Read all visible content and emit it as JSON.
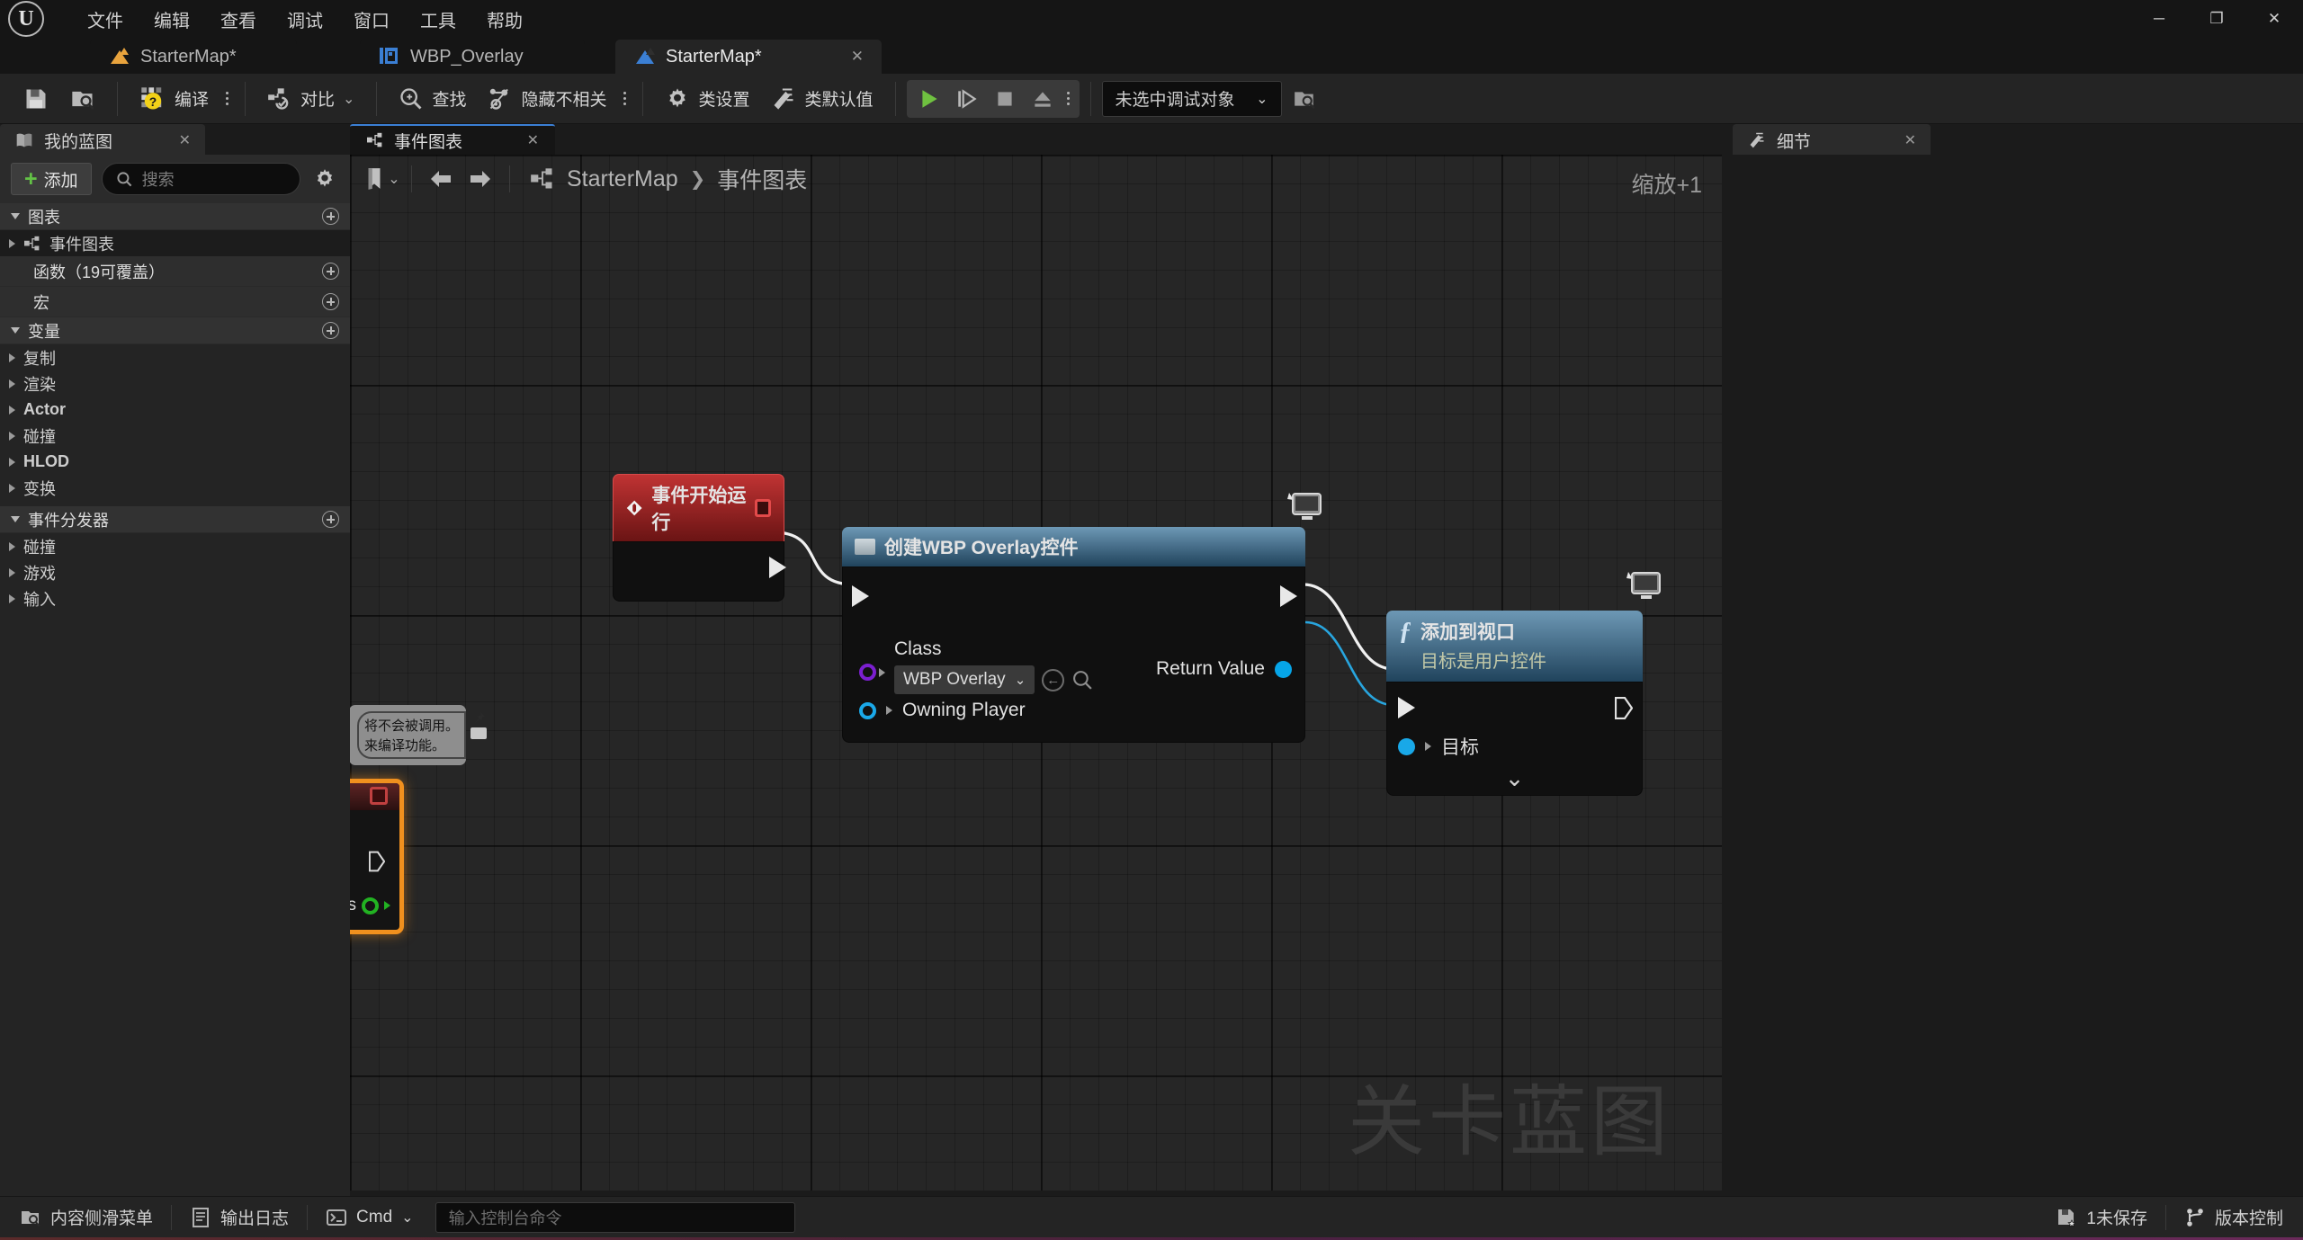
{
  "app": {
    "logo": "unreal-engine-logo",
    "menu": [
      "文件",
      "编辑",
      "查看",
      "调试",
      "窗口",
      "工具",
      "帮助"
    ],
    "window_controls": {
      "minimize": "─",
      "maximize": "❐",
      "close": "✕"
    }
  },
  "document_tabs": [
    {
      "label": "StarterMap*",
      "icon": "map-icon",
      "active": false,
      "closable": false
    },
    {
      "label": "WBP_Overlay",
      "icon": "widget-blueprint-icon",
      "active": false,
      "closable": false
    },
    {
      "label": "StarterMap*",
      "icon": "level-blueprint-icon",
      "active": true,
      "closable": true,
      "close": "✕"
    }
  ],
  "toolbar": {
    "save_icon": "save-icon",
    "browse_icon": "browse-content-icon",
    "compile_label": "编译",
    "compile_icon": "compile-icon",
    "diff_label": "对比",
    "diff_icon": "diff-icon",
    "find_label": "查找",
    "find_icon": "find-icon",
    "hide_unrelated_label": "隐藏不相关",
    "hide_unrelated_icon": "hide-unrelated-icon",
    "class_settings_label": "类设置",
    "class_settings_icon": "gear-icon",
    "class_defaults_label": "类默认值",
    "class_defaults_icon": "edit-icon",
    "play_icon": "play-icon",
    "step_icon": "step-icon",
    "stop_icon": "stop-icon",
    "eject_icon": "eject-icon",
    "debug_object_value": "未选中调试对象",
    "debug_browse_icon": "browse-icon",
    "chevron": "⌄"
  },
  "my_blueprint": {
    "panel_title": "我的蓝图",
    "panel_icon": "book-icon",
    "close": "✕",
    "add_label": "添加",
    "search_placeholder": "搜索",
    "search_icon": "search-icon",
    "settings_icon": "gear-icon",
    "sections": [
      {
        "title": "图表",
        "expanded": true,
        "has_add": true,
        "items": [
          {
            "label": "事件图表",
            "icon": "graph-icon",
            "selected": true,
            "expandable": true
          }
        ]
      },
      {
        "title": "函数（19可覆盖）",
        "expanded": false,
        "has_add": true,
        "items": []
      },
      {
        "title": "宏",
        "expanded": false,
        "has_add": true,
        "items": []
      },
      {
        "title": "变量",
        "expanded": true,
        "has_add": true,
        "items": [
          {
            "label": "复制",
            "expandable": true
          },
          {
            "label": "渲染",
            "expandable": true
          },
          {
            "label": "Actor",
            "expandable": true
          },
          {
            "label": "碰撞",
            "expandable": true
          },
          {
            "label": "HLOD",
            "expandable": true
          },
          {
            "label": "变换",
            "expandable": true
          }
        ]
      },
      {
        "title": "事件分发器",
        "expanded": true,
        "has_add": true,
        "items": [
          {
            "label": "碰撞",
            "expandable": true
          },
          {
            "label": "游戏",
            "expandable": true
          },
          {
            "label": "输入",
            "expandable": true
          }
        ]
      }
    ]
  },
  "graph": {
    "tab_label": "事件图表",
    "tab_icon": "graph-icon",
    "tab_close": "✕",
    "bookmark_icon": "bookmark-icon",
    "bookmark_chevron": "⌄",
    "back_icon": "arrow-left-icon",
    "forward_icon": "arrow-right-icon",
    "breadcrumb_icon": "graph-icon",
    "breadcrumb": [
      "StarterMap",
      "事件图表"
    ],
    "breadcrumb_separator": "❯",
    "zoom_label": "缩放+1",
    "watermark": "关卡蓝图",
    "nodes": [
      {
        "id": "event-begin-play",
        "title": "事件开始运行",
        "icon": "event-diamond-icon",
        "badge": "red-square-badge",
        "exec_out": true
      },
      {
        "id": "create-wbp-overlay-widget",
        "title": "创建WBP Overlay控件",
        "icon": "widget-node-icon",
        "exec_in": true,
        "exec_out": true,
        "pins_in": [
          {
            "label": "Class",
            "type": "class",
            "color": "#7b1fd0",
            "value": "WBP Overlay",
            "chevron": "⌄"
          },
          {
            "label": "Owning Player",
            "type": "object",
            "color": "#1aa8e8"
          }
        ],
        "pins_out": [
          {
            "label": "Return Value",
            "type": "object",
            "color": "#06a5e8"
          }
        ],
        "reset_icon": "reset-arrow-icon",
        "browse_icon": "search-icon",
        "comment_bubble": "monitor-icon"
      },
      {
        "id": "add-to-viewport",
        "title": "添加到视口",
        "subtitle": "目标是用户控件",
        "icon": "function-f-icon",
        "exec_in": true,
        "exec_out": true,
        "pins_in": [
          {
            "label": "目标",
            "type": "object",
            "color": "#19a8e8"
          }
        ],
        "expand_chevron": "⌄",
        "comment_bubble": "monitor-icon"
      },
      {
        "id": "disabled-node-comment",
        "lines": [
          "将不会被调用。",
          "来编译功能。"
        ],
        "pin_icon": "pin-icon"
      },
      {
        "id": "selected-node-partial",
        "badge": "red-square-badge",
        "pin_label": "ds",
        "pin_color": "#22b222",
        "selected": true
      }
    ]
  },
  "details": {
    "panel_title": "细节",
    "panel_icon": "details-icon",
    "close": "✕"
  },
  "status_bar": {
    "content_drawer_label": "内容侧滑菜单",
    "content_drawer_icon": "drawer-icon",
    "output_log_label": "输出日志",
    "output_log_icon": "log-icon",
    "cmd_label": "Cmd",
    "cmd_icon": "console-icon",
    "cmd_chevron": "⌄",
    "console_placeholder": "输入控制台命令",
    "unsaved_label": "1未保存",
    "unsaved_icon": "save-star-icon",
    "source_control_label": "版本控制",
    "source_control_icon": "branch-icon"
  },
  "colors": {
    "accent_blue": "#3b7fd4",
    "exec_white": "#e8e8e8",
    "class_pin": "#7b1fd0",
    "object_pin": "#1aa8e8",
    "event_red": "#c03333",
    "function_blue": "#20435c",
    "add_green": "#63c246",
    "play_green": "#6fc140",
    "selected_orange": "#f0901e"
  }
}
